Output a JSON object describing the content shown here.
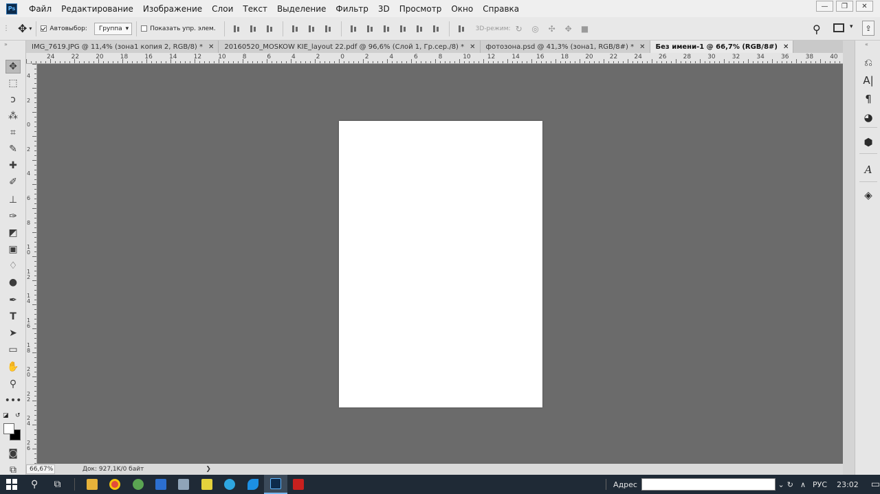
{
  "app": {
    "logo_text": "Ps"
  },
  "menu": [
    "Файл",
    "Редактирование",
    "Изображение",
    "Слои",
    "Текст",
    "Выделение",
    "Фильтр",
    "3D",
    "Просмотр",
    "Окно",
    "Справка"
  ],
  "window_controls": {
    "minimize": "—",
    "restore": "❐",
    "close": "✕"
  },
  "options": {
    "autoselect_label": "Автовыбор:",
    "autoselect_checked": true,
    "autoselect_value": "Группа",
    "show_controls_label": "Показать упр. элем.",
    "show_controls_checked": false,
    "mode_3d_label": "3D-режим:"
  },
  "tabs": [
    {
      "label": "IMG_7619.JPG @ 11,4% (зона1 копия 2, RGB/8) *",
      "close": "✕",
      "active": false
    },
    {
      "label": "20160520_MOSKOW KIE_layout 22.pdf @ 96,6% (Слой 1, Гр.сер./8) *",
      "close": "✕",
      "active": false
    },
    {
      "label": "фотозона.psd @ 41,3% (зона1, RGB/8#) *",
      "close": "✕",
      "active": false
    },
    {
      "label": "Без имени-1 @ 66,7% (RGB/8#)",
      "close": "✕",
      "active": true
    }
  ],
  "ruler_top": [
    "24",
    "22",
    "20",
    "18",
    "16",
    "14",
    "12",
    "10",
    "8",
    "6",
    "4",
    "2",
    "0",
    "2",
    "4",
    "6",
    "8",
    "10",
    "12",
    "14",
    "16",
    "18",
    "20",
    "22",
    "24",
    "26",
    "28",
    "30",
    "32",
    "34",
    "36",
    "38",
    "40"
  ],
  "ruler_left": [
    "4",
    "2",
    "0",
    "2",
    "4",
    "6",
    "8",
    "1 0",
    "1 2",
    "1 4",
    "1 6",
    "1 8",
    "2 0",
    "2 2",
    "2 4",
    "2 6"
  ],
  "status": {
    "zoom": "66,67%",
    "doc_info": "Док: 927,1K/0 байт",
    "arrow": "❯"
  },
  "taskbar": {
    "address_label": "Адрес",
    "address_value": "",
    "language": "РУС",
    "time": "23:02"
  },
  "colors": {
    "canvas_bg": "#6b6b6b",
    "document_bg": "#ffffff",
    "taskbar": "#1f2a36"
  }
}
